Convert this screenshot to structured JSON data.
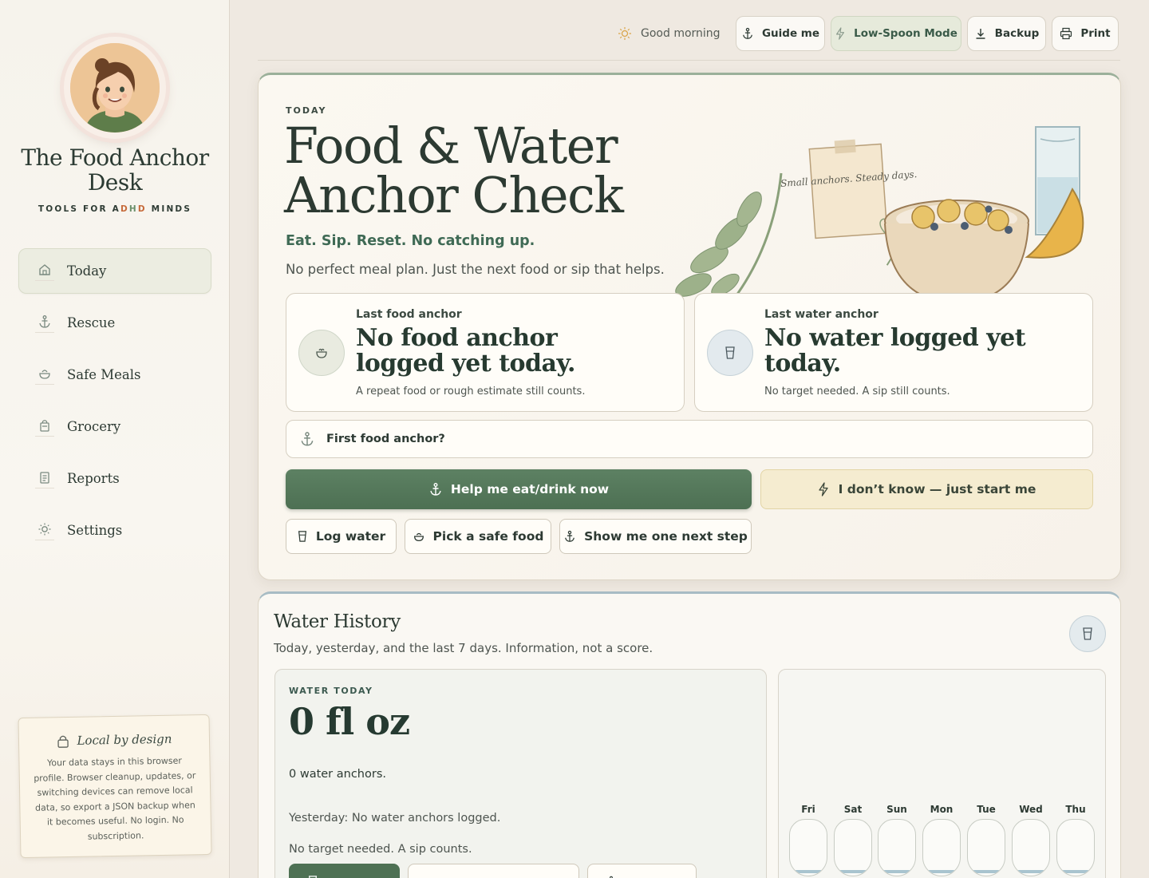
{
  "sidebar": {
    "brand_title": "The Food Anchor Desk",
    "brand_sub_1": "TOOLS FOR A",
    "brand_sub_2": "D",
    "brand_sub_3": "H",
    "brand_sub_4": "D",
    "brand_sub_5": " MINDS",
    "nav": [
      {
        "label": "Today",
        "icon": "home-icon",
        "active": true
      },
      {
        "label": "Rescue",
        "icon": "anchor-icon"
      },
      {
        "label": "Safe Meals",
        "icon": "bowl-icon"
      },
      {
        "label": "Grocery",
        "icon": "grocery-bag-icon"
      },
      {
        "label": "Reports",
        "icon": "report-icon"
      },
      {
        "label": "Settings",
        "icon": "sun-gear-icon"
      }
    ],
    "local_title": "Local by design",
    "local_body": "Your data stays in this browser profile. Browser cleanup, updates, or switching devices can remove local data, so export a JSON backup when it becomes useful. No login. No subscription."
  },
  "topbar": {
    "greeting": "Good morning",
    "guide": "Guide me",
    "low_spoon": "Low-Spoon Mode",
    "backup": "Backup",
    "print": "Print"
  },
  "hero": {
    "eyebrow": "TODAY",
    "title": "Food & Water Anchor Check",
    "tagline": "Eat. Sip. Reset. No catching up.",
    "lede": "No perfect meal plan. Just the next food or sip that helps.",
    "note_text": "Small anchors. Steady days.",
    "food_card": {
      "label": "Last food anchor",
      "status": "No food anchor logged yet today.",
      "hint": "A repeat food or rough estimate still counts."
    },
    "water_card": {
      "label": "Last water anchor",
      "status": "No water logged yet today.",
      "hint": "No target needed. A sip still counts."
    },
    "first_anchor": "First food anchor?",
    "primary": "Help me eat/drink now",
    "just_start": "I don’t know — just start me",
    "log_water": "Log water",
    "safe_food": "Pick a safe food",
    "next_step": "Show me one next step"
  },
  "water": {
    "title": "Water History",
    "subtitle": "Today, yesterday, and the last 7 days. Information, not a score.",
    "eyebrow": "WATER TODAY",
    "amount": "0 fl oz",
    "anchors": "0 water anchors.",
    "yesterday": "Yesterday: No water anchors logged.",
    "target_note": "No target needed. A sip counts.",
    "days": [
      "Fri",
      "Sat",
      "Sun",
      "Mon",
      "Tue",
      "Wed",
      "Thu"
    ],
    "day_levels": [
      0,
      0,
      0,
      0,
      0,
      0,
      0
    ]
  },
  "colors": {
    "accent_green": "#4e7154",
    "soft_yellow": "#f5ecd0",
    "water_blue": "#a7bcc4"
  }
}
